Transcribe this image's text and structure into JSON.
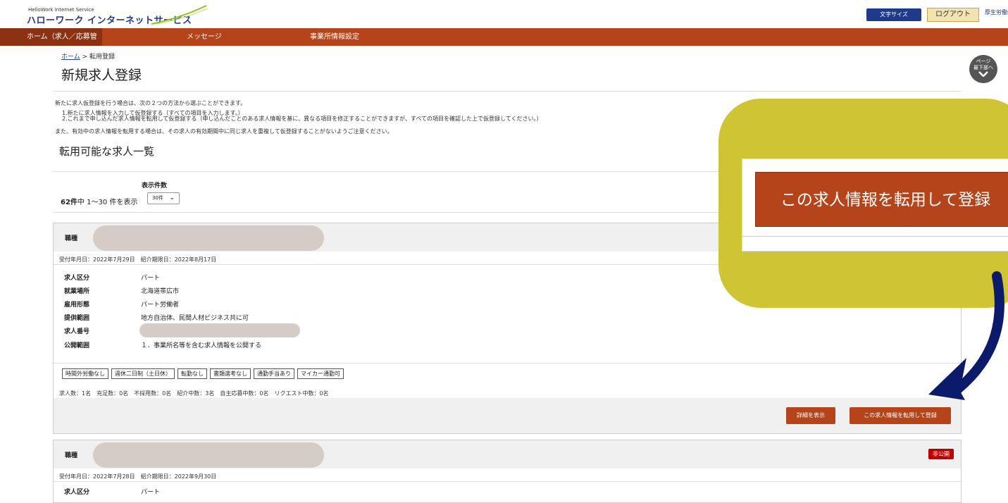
{
  "header": {
    "service_small": "HelloWork Internet Service",
    "service_title": "ハローワーク インターネットサービス",
    "fontsize_label": "文字サイズ",
    "logout_label": "ログアウト",
    "ministry_label": "厚生労働省"
  },
  "nav": {
    "home": "ホーム（求人／応募管理）",
    "messages": "メッセージ",
    "office_settings": "事業所情報設定"
  },
  "breadcrumb": {
    "home": "ホーム",
    "separator": ">",
    "current": "転用登録"
  },
  "page_title": "新規求人登録",
  "page_down": {
    "line1": "ページ",
    "line2": "最下部へ"
  },
  "intro": {
    "line1": "新たに求人仮登録を行う場合は、次の２つの方法から選ぶことができます。",
    "line2": "1.新たに求人情報を入力して仮登録する（すべての項目を入力します。）",
    "line3": "2.これまで申し込んだ求人情報を転用して仮登録する（申し込んだことのある求人情報を基に、異なる項目を修正することができますが、すべての項目を確認した上で仮登録してください。）",
    "line4": "また、有効中の求人情報を転用する場合は、その求人の有効期間中に同じ求人を重複して仮登録することがないようご注意ください。"
  },
  "section_title": "転用可能な求人一覧",
  "listing": {
    "count_label": "表示件数",
    "total": "62件",
    "range": "中 1～30 件を表示",
    "select_value": "30件"
  },
  "cards": [
    {
      "job_label": "職種",
      "dates": "受付年月日：2022年7月29日　紹介期限日：2022年8月17日",
      "fields": [
        {
          "label": "求人区分",
          "value": "パート"
        },
        {
          "label": "就業場所",
          "value": "北海道帯広市"
        },
        {
          "label": "雇用形態",
          "value": "パート労働者"
        },
        {
          "label": "提供範囲",
          "value": "地方自治体、民間人材ビジネス共に可"
        },
        {
          "label": "求人番号",
          "value": ""
        },
        {
          "label": "公開範囲",
          "value": "１．事業所名等を含む求人情報を公開する"
        }
      ],
      "tags": [
        "時間外労働なし",
        "週休二日制（土日休）",
        "転勤なし",
        "書類選考なし",
        "通勤手当あり",
        "マイカー通勤可"
      ],
      "stats": "求人数：1名　充足数：0名　不採用数：0名　紹介中数：3名　自主応募中数：0名　リクエスト中数：0名",
      "detail_button": "詳細を表示",
      "reuse_button": "この求人情報を転用して登録"
    },
    {
      "job_label": "職種",
      "badge": "非公開",
      "dates": "受付年月日：2022年7月28日　紹介期限日：2022年9月30日",
      "fields": [
        {
          "label": "求人区分",
          "value": "パート"
        }
      ]
    }
  ],
  "callout": {
    "button": "この求人情報を転用して登録"
  },
  "colors": {
    "brand": "#b5441a",
    "callout": "#cfc433",
    "arrow": "#0b1a6b",
    "private": "#c00000"
  }
}
